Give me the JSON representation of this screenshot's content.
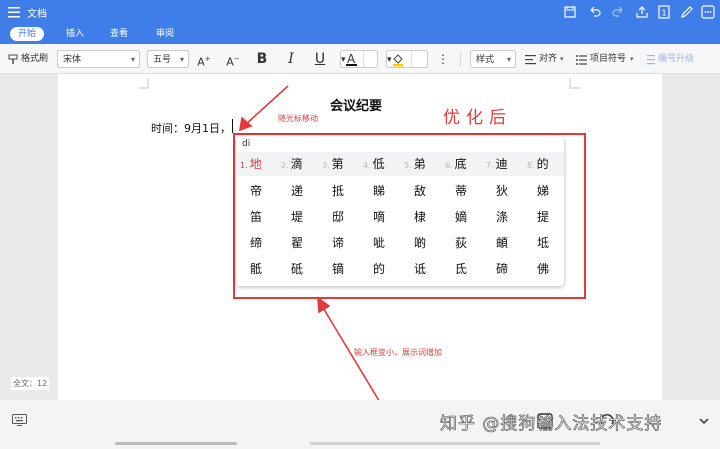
{
  "titlebar": {
    "title": "文档"
  },
  "tabs": [
    {
      "label": "开始",
      "active": true
    },
    {
      "label": "插入"
    },
    {
      "label": "查看"
    },
    {
      "label": "审阅"
    }
  ],
  "toolbar": {
    "format_painter": "格式刷",
    "font": "宋体",
    "size": "五号",
    "grow_font": "A",
    "shrink_font": "A",
    "bold": "B",
    "italic": "I",
    "underline": "U",
    "font_color": "A",
    "styles": "样式",
    "align": "对齐",
    "bullets": "项目符号",
    "indent": "编号升级"
  },
  "doc": {
    "title": "会议纪要",
    "time_line": "时间：9月1日，"
  },
  "annotations": {
    "follow": "随光标移动",
    "optimized": "优化后",
    "shrink": "输入框变小，展示词增加"
  },
  "ime": {
    "pinyin": "di",
    "row1": [
      {
        "n": "1.",
        "c": "地"
      },
      {
        "n": "2.",
        "c": "滴"
      },
      {
        "n": "3.",
        "c": "第"
      },
      {
        "n": "4.",
        "c": "低"
      },
      {
        "n": "5.",
        "c": "弟"
      },
      {
        "n": "6.",
        "c": "底"
      },
      {
        "n": "7.",
        "c": "迪"
      },
      {
        "n": "8.",
        "c": "的"
      }
    ],
    "rows": [
      [
        "帝",
        "递",
        "抵",
        "睇",
        "敌",
        "蒂",
        "狄",
        "娣"
      ],
      [
        "笛",
        "堤",
        "邸",
        "嘀",
        "棣",
        "嫡",
        "涤",
        "提"
      ],
      [
        "缔",
        "翟",
        "谛",
        "呲",
        "啲",
        "荻",
        "頔",
        "坻"
      ],
      [
        "骶",
        "砥",
        "镝",
        "的",
        "诋",
        "氐",
        "碲",
        "佛"
      ]
    ]
  },
  "status": {
    "wordcount": "全文：12"
  },
  "watermark": "知乎 @搜狗输入法技术支持",
  "colors": {
    "accent": "#3f7de8",
    "annotation": "#e03a3a"
  }
}
